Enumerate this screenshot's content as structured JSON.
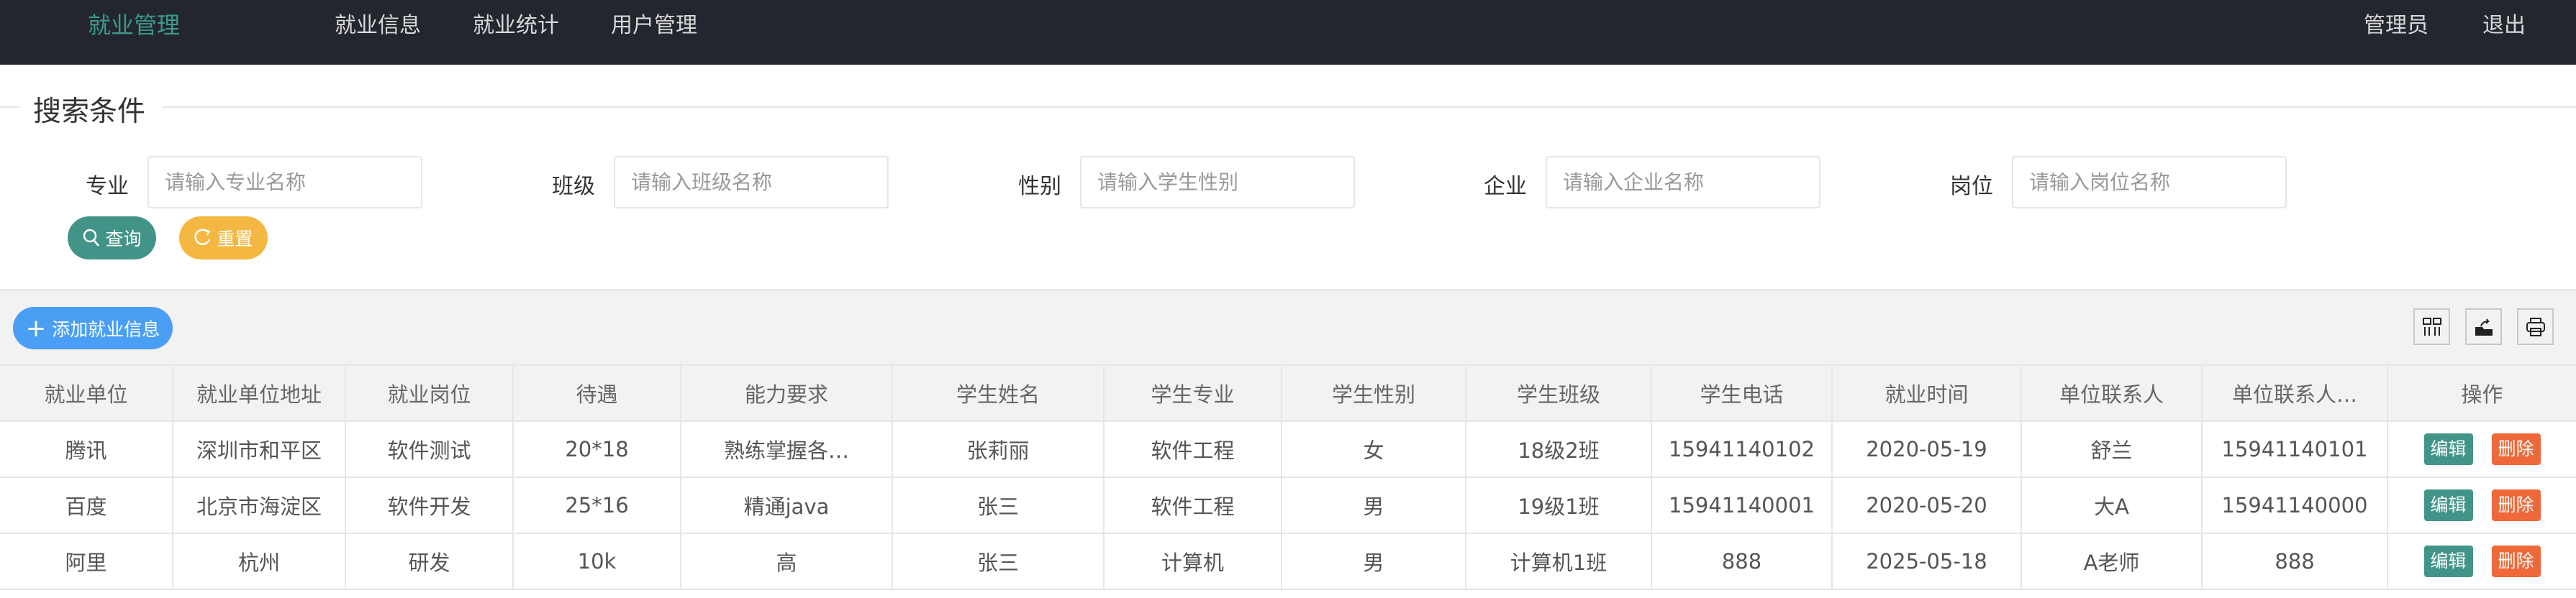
{
  "nav": {
    "logo": "就业管理",
    "items": [
      "就业信息",
      "就业统计",
      "用户管理"
    ],
    "user": "管理员",
    "logout": "退出"
  },
  "search": {
    "legend": "搜索条件",
    "fields": [
      {
        "label": "专业",
        "placeholder": "请输入专业名称",
        "value": ""
      },
      {
        "label": "班级",
        "placeholder": "请输入班级名称",
        "value": ""
      },
      {
        "label": "性别",
        "placeholder": "请输入学生性别",
        "value": ""
      },
      {
        "label": "企业",
        "placeholder": "请输入企业名称",
        "value": ""
      },
      {
        "label": "岗位",
        "placeholder": "请输入岗位名称",
        "value": ""
      }
    ],
    "query_label": "查询",
    "reset_label": "重置"
  },
  "toolbar": {
    "add_label": "添加就业信息",
    "icons": [
      "columns-icon",
      "export-icon",
      "print-icon"
    ]
  },
  "colors": {
    "nav_bg": "#23262e",
    "accent": "#429488",
    "warn": "#f4b842",
    "primary": "#4a9ff5",
    "danger": "#ee6839"
  },
  "table": {
    "headers": [
      "就业单位",
      "就业单位地址",
      "就业岗位",
      "待遇",
      "能力要求",
      "学生姓名",
      "学生专业",
      "学生性别",
      "学生班级",
      "学生电话",
      "就业时间",
      "单位联系人",
      "单位联系人…",
      "操作"
    ],
    "rows": [
      [
        "腾讯",
        "深圳市和平区",
        "软件测试",
        "20*18",
        "熟练掌握各…",
        "张莉丽",
        "软件工程",
        "女",
        "18级2班",
        "15941140102",
        "2020-05-19",
        "舒兰",
        "15941140101"
      ],
      [
        "百度",
        "北京市海淀区",
        "软件开发",
        "25*16",
        "精通java",
        "张三",
        "软件工程",
        "男",
        "19级1班",
        "15941140001",
        "2020-05-20",
        "大A",
        "15941140000"
      ],
      [
        "阿里",
        "杭州",
        "研发",
        "10k",
        "高",
        "张三",
        "计算机",
        "男",
        "计算机1班",
        "888",
        "2025-05-18",
        "A老师",
        "888"
      ]
    ],
    "edit_label": "编辑",
    "delete_label": "删除"
  }
}
